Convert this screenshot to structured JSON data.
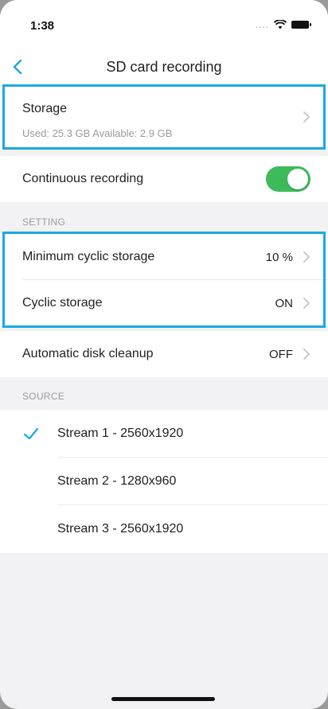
{
  "status_bar": {
    "time": "1:38",
    "signal_dots": "....",
    "wifi_icon": "wifi-icon",
    "battery_icon": "battery-icon"
  },
  "nav": {
    "title": "SD card recording",
    "back_icon": "chevron-left-icon"
  },
  "storage": {
    "label": "Storage",
    "details": "Used: 25.3 GB Available: 2.9 GB"
  },
  "continuous_recording": {
    "label": "Continuous recording",
    "enabled": true
  },
  "setting": {
    "header": "SETTING",
    "items": [
      {
        "label": "Minimum cyclic storage",
        "value": "10 %"
      },
      {
        "label": "Cyclic storage",
        "value": "ON"
      },
      {
        "label": "Automatic disk cleanup",
        "value": "OFF"
      }
    ]
  },
  "source": {
    "header": "SOURCE",
    "streams": [
      {
        "label": "Stream 1 - 2560x1920",
        "selected": true
      },
      {
        "label": "Stream 2 - 1280x960",
        "selected": false
      },
      {
        "label": "Stream 3 - 2560x1920",
        "selected": false
      }
    ]
  },
  "colors": {
    "accent": "#1aa9e3",
    "toggle_on": "#3dbb5a",
    "check": "#1aa9e3",
    "secondary_text": "#9a9a9a"
  }
}
